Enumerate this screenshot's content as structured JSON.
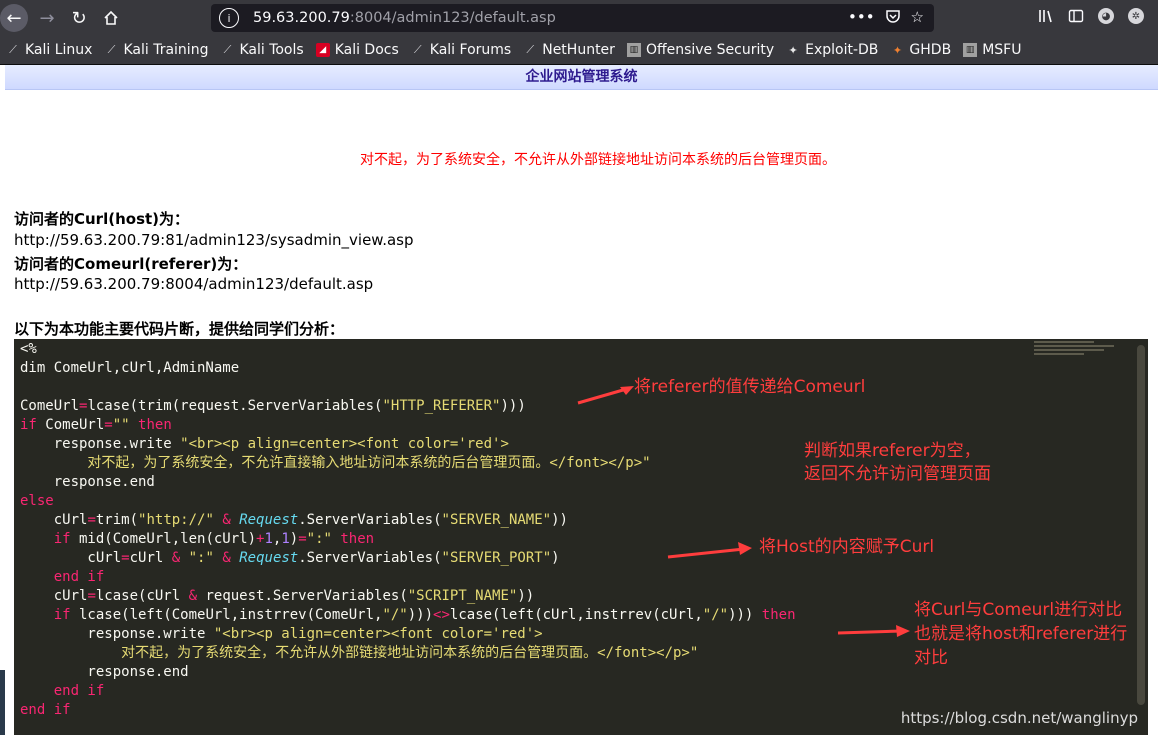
{
  "browser": {
    "url_host": "59.63.200.79",
    "url_rest": ":8004/admin123/default.asp",
    "more_glyph": "•••"
  },
  "bookmarks": [
    {
      "label": "Kali Linux",
      "icon": "kali-dragon-icon"
    },
    {
      "label": "Kali Training",
      "icon": "kali-dragon-icon"
    },
    {
      "label": "Kali Tools",
      "icon": "kali-dragon-icon"
    },
    {
      "label": "Kali Docs",
      "icon": "kali-docs-icon"
    },
    {
      "label": "Kali Forums",
      "icon": "kali-dragon-icon"
    },
    {
      "label": "NetHunter",
      "icon": "kali-dragon-icon"
    },
    {
      "label": "Offensive Security",
      "icon": "offsec-icon"
    },
    {
      "label": "Exploit-DB",
      "icon": "exploit-db-icon"
    },
    {
      "label": "GHDB",
      "icon": "ghdb-icon"
    },
    {
      "label": "MSFU",
      "icon": "offsec-icon"
    }
  ],
  "page": {
    "title": "企业网站管理系统",
    "alert": "对不起，为了系统安全，不允许从外部链接地址访问本系统的后台管理页面。",
    "host_label": "访问者的Curl(host)为：",
    "host_value": "http://59.63.200.79:81/admin123/sysadmin_view.asp",
    "referer_label": "访问者的Comeurl(referer)为：",
    "referer_value": "http://59.63.200.79:8004/admin123/default.asp",
    "code_intro": "以下为本功能主要代码片断，提供给同学们分析："
  },
  "annotations": {
    "a1": "将referer的值传递给Comeurl",
    "a2_line1": "判断如果referer为空，",
    "a2_line2": "返回不允许访问管理页面",
    "a3": "将Host的内容赋予Curl",
    "a4_line1": "将Curl与Comeurl进行对比",
    "a4_line2": "也就是将host和referer进行",
    "a4_line3": "对比"
  },
  "watermark": "https://blog.csdn.net/wanglinyp",
  "colors": {
    "code_bg": "#272822",
    "keyword": "#f92672",
    "string": "#e6db74",
    "number": "#ae81ff",
    "annotation": "#ff3d3d",
    "alert": "#ff0000"
  }
}
